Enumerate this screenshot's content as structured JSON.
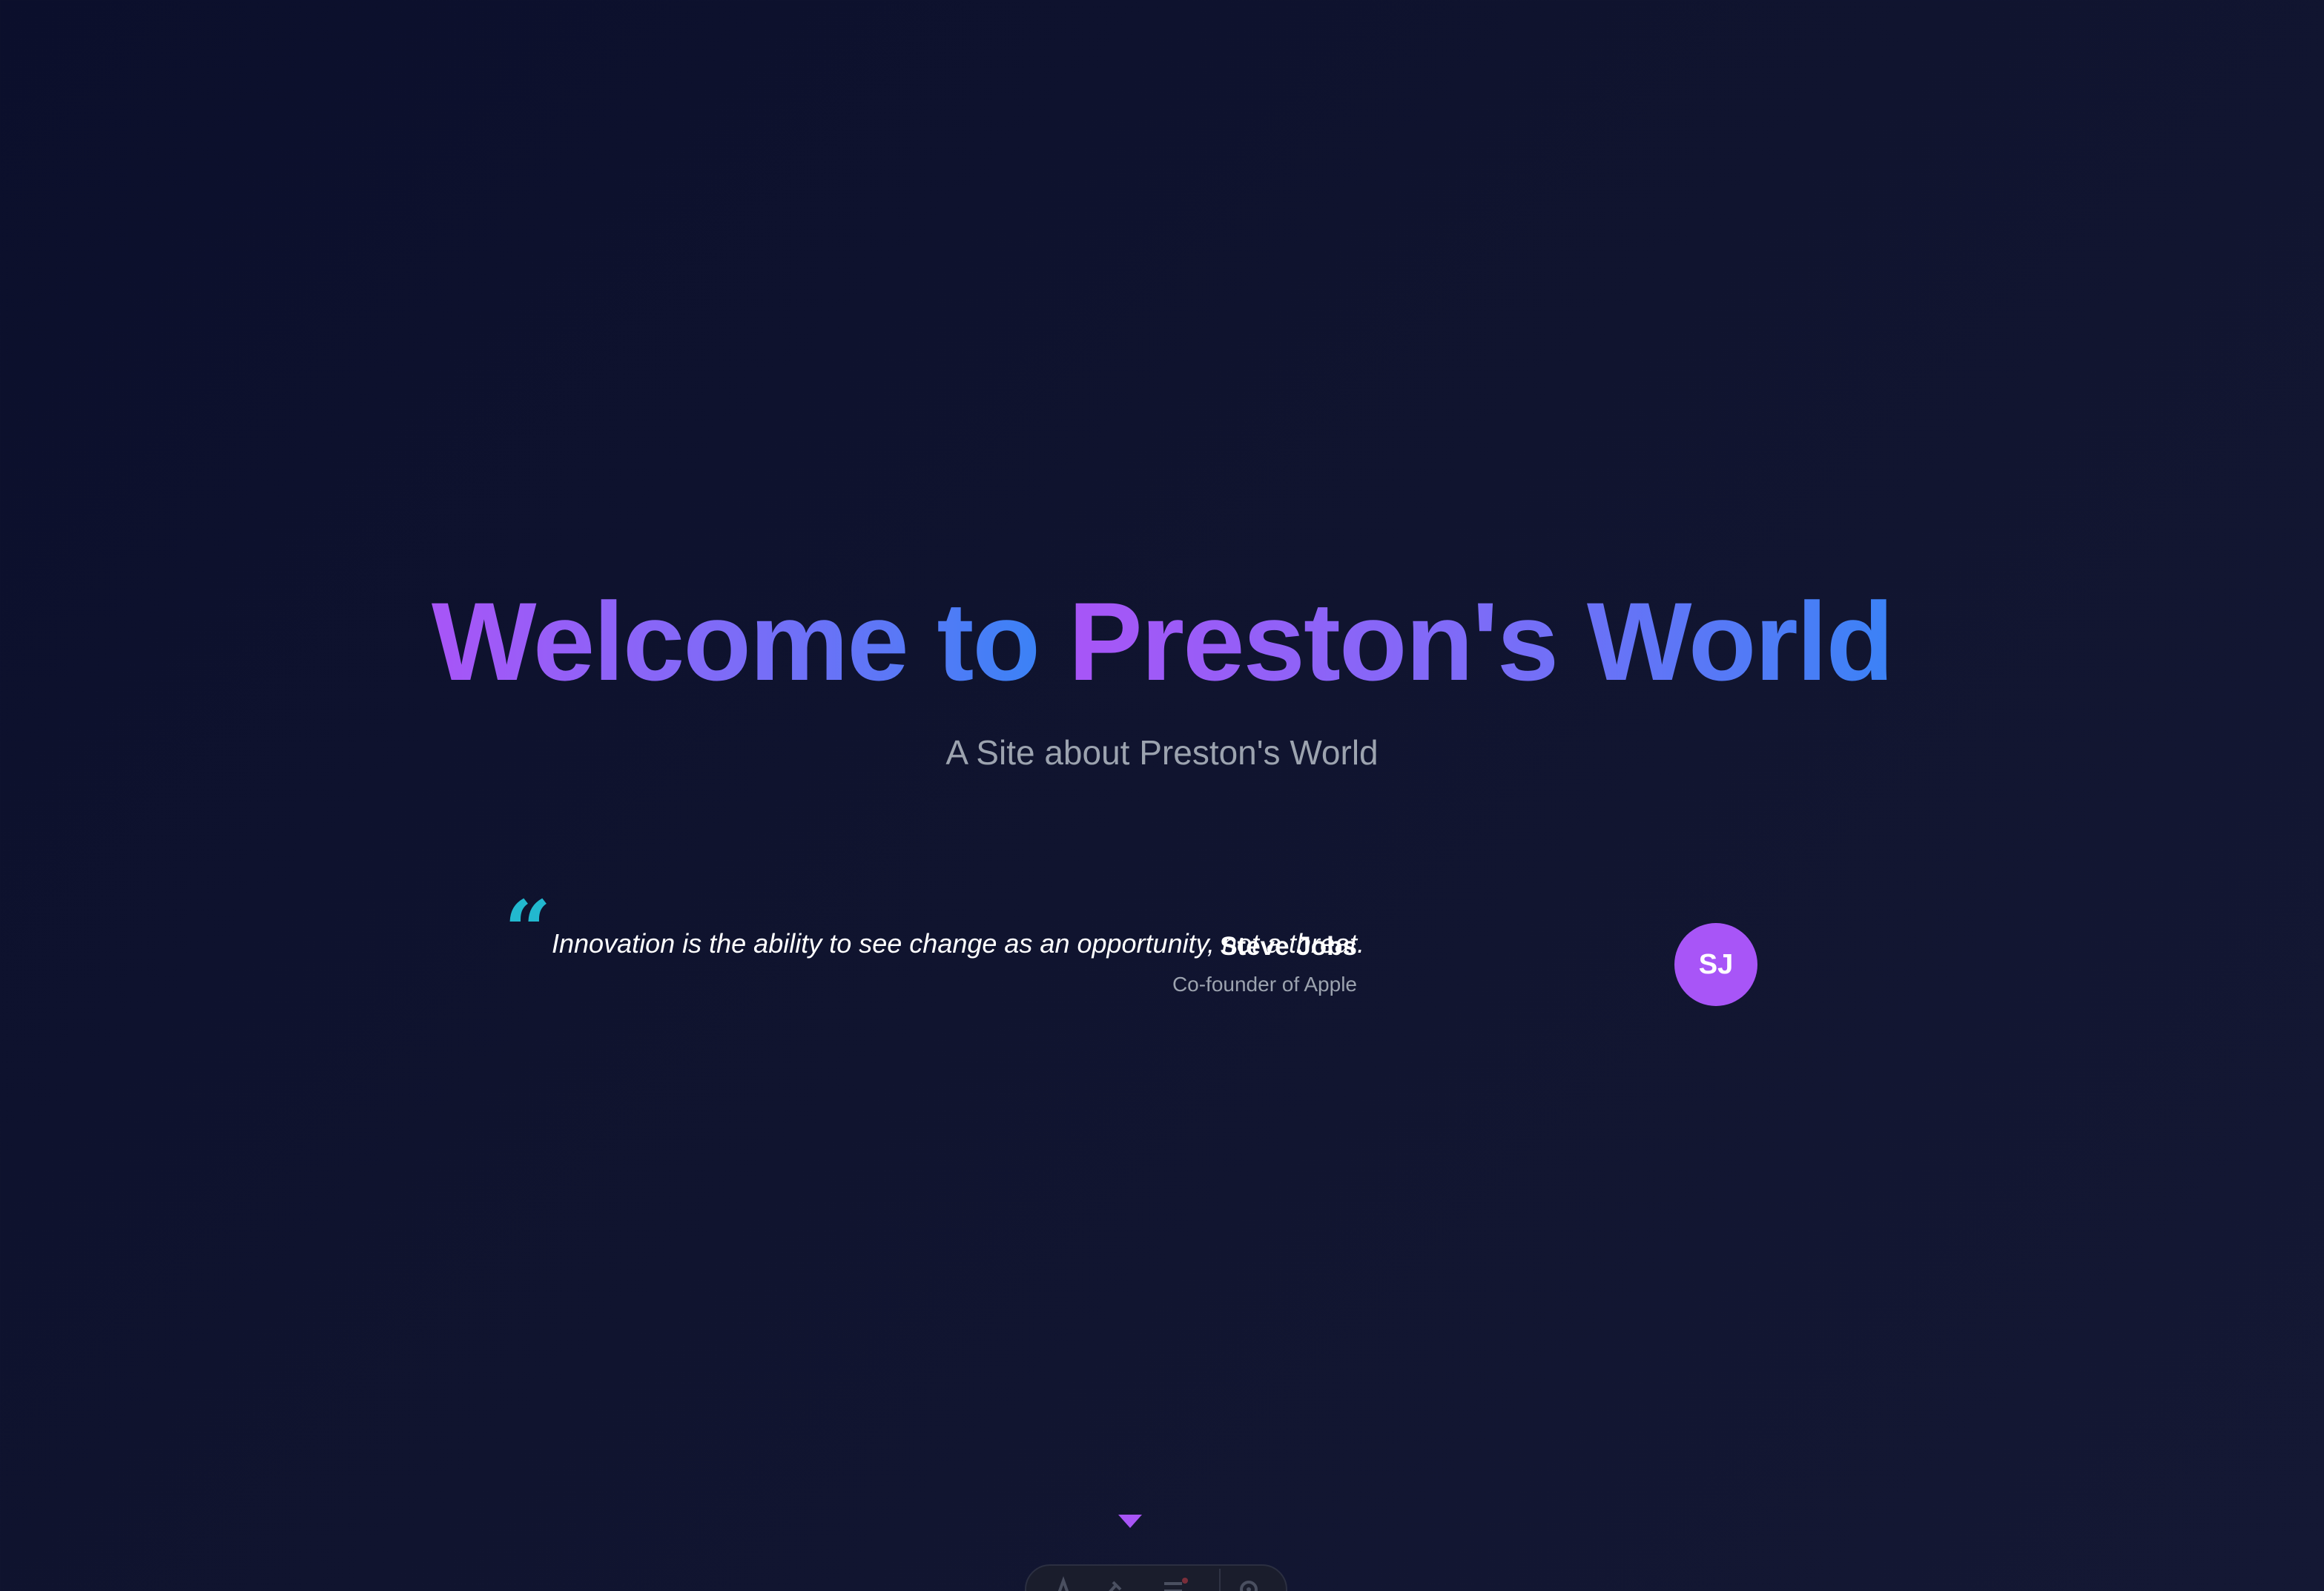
{
  "hero": {
    "title_part1": "Welcome to",
    "title_part2": "Preston's World",
    "subtitle": "A Site about Preston's World"
  },
  "quote": {
    "mark": "“",
    "text": "Innovation is the ability to see change as an opportunity, not a threat.",
    "author_name": "Steve Jobs",
    "author_role": "Co-founder of Apple",
    "avatar_initials": "SJ"
  },
  "colors": {
    "background": "#0f1330",
    "gradient_start": "#a855f7",
    "gradient_end": "#3b82f6",
    "quote_mark": "#22b8cf",
    "avatar": "#a855f7",
    "muted_text": "#9ca3af"
  },
  "dock": {
    "icons": [
      "text-icon",
      "brush-icon",
      "list-icon",
      "settings-icon"
    ]
  },
  "scroll_indicator": {
    "icon": "chevron-down-icon"
  }
}
